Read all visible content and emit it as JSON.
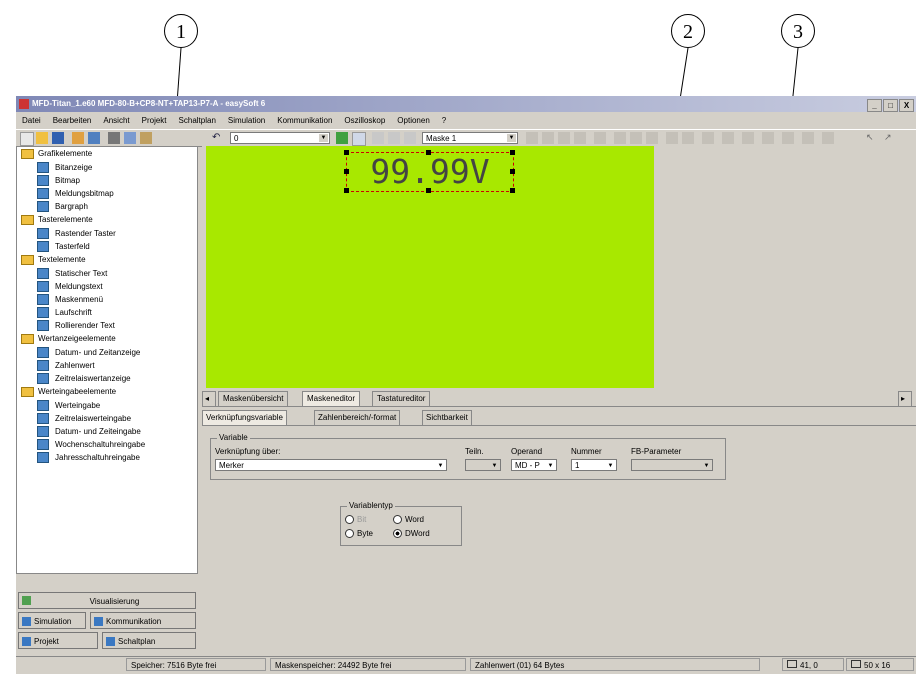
{
  "callouts": [
    "1",
    "2",
    "3"
  ],
  "window": {
    "title": "MFD-Titan_1.e60 MFD-80-B+CP8-NT+TAP13-P7-A - easySoft 6",
    "controls": [
      "_",
      "□",
      "X"
    ]
  },
  "menu": [
    "Datei",
    "Bearbeiten",
    "Ansicht",
    "Projekt",
    "Schaltplan",
    "Simulation",
    "Kommunikation",
    "Oszilloskop",
    "Optionen",
    "?"
  ],
  "toolbar": {
    "combo1_value": "0",
    "combo2_value": "Maske 1"
  },
  "tree": [
    {
      "label": "Grafikelemente",
      "items": [
        "Bitanzeige",
        "Bitmap",
        "Meldungsbitmap",
        "Bargraph"
      ]
    },
    {
      "label": "Tasterelemente",
      "items": [
        "Rastender Taster",
        "Tasterfeld"
      ]
    },
    {
      "label": "Textelemente",
      "items": [
        "Statischer Text",
        "Meldungstext",
        "Maskenmenü",
        "Laufschrift",
        "Rollierender Text"
      ]
    },
    {
      "label": "Wertanzeigeelemente",
      "items": [
        "Datum- und Zeitanzeige",
        "Zahlenwert",
        "Zeitrelaiswertanzeige"
      ]
    },
    {
      "label": "Werteingabeelemente",
      "items": [
        "Werteingabe",
        "Zeitrelaiswerteingabe",
        "Datum- und Zeiteingabe",
        "Wochenschaltuhreingabe",
        "Jahresschaltuhreingabe"
      ]
    }
  ],
  "nav": {
    "visualisierung": "Visualisierung",
    "simulation": "Simulation",
    "kommunikation": "Kommunikation",
    "projekt": "Projekt",
    "schaltplan": "Schaltplan"
  },
  "editor": {
    "lcd_text": "99.99V",
    "lcd_color": "#a8e800",
    "tabs": [
      "Maskenübersicht",
      "Maskeneditor",
      "Tastatureditor"
    ]
  },
  "props": {
    "tabs": [
      "Verknüpfungsvariable",
      "Zahlenbereich/-format",
      "Sichtbarkeit"
    ],
    "variable": {
      "group_label": "Variable",
      "link_label": "Verknüpfung über:",
      "link_value": "Merker",
      "teiln_label": "Teiln.",
      "operand_label": "Operand",
      "operand_value": "MD - P",
      "nummer_label": "Nummer",
      "nummer_value": "1",
      "fb_label": "FB-Parameter"
    },
    "vartyp": {
      "group_label": "Variablentyp",
      "bit": "Bit",
      "word": "Word",
      "byte": "Byte",
      "dword": "DWord",
      "selected": "DWord"
    }
  },
  "status": {
    "speicher": "Speicher: 7516 Byte frei",
    "maskenspeicher": "Maskenspeicher: 24492 Byte frei",
    "zahlenwert": "Zahlenwert (01)  64 Bytes",
    "pos": "41, 0",
    "size": "50 x 16"
  }
}
